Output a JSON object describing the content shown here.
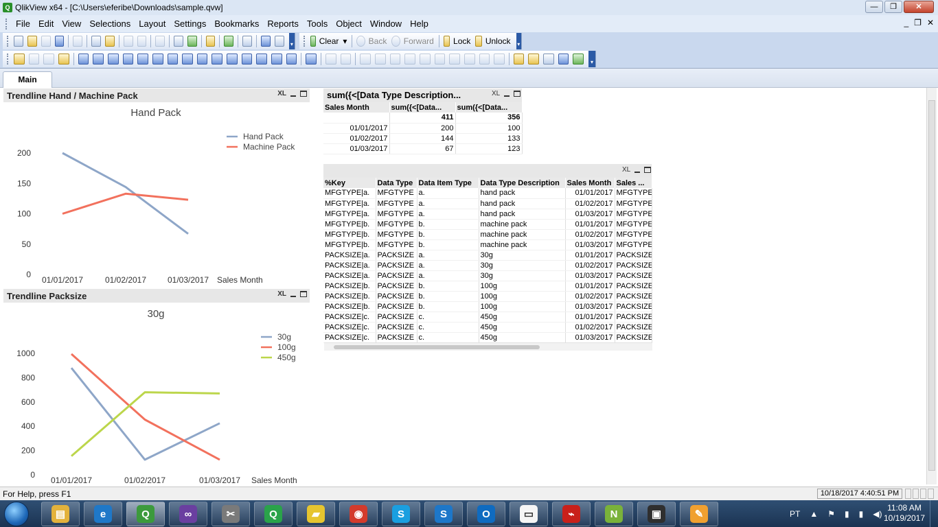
{
  "window": {
    "title": "QlikView x64 - [C:\\Users\\eferibe\\Downloads\\sample.qvw]",
    "min_label": "—",
    "max_label": "❐",
    "close_label": "✕"
  },
  "menu": [
    "File",
    "Edit",
    "View",
    "Selections",
    "Layout",
    "Settings",
    "Bookmarks",
    "Reports",
    "Tools",
    "Object",
    "Window",
    "Help"
  ],
  "mdi_controls": [
    "_",
    "❐",
    "✕"
  ],
  "toolbar": {
    "clear_label": "Clear",
    "back_label": "Back",
    "forward_label": "Forward",
    "lock_label": "Lock",
    "unlock_label": "Unlock"
  },
  "tabs": [
    "Main"
  ],
  "chart1": {
    "caption": "Trendline Hand / Machine Pack",
    "xl": "XL",
    "chart_data": {
      "type": "line",
      "title": "Hand Pack",
      "xlabel": "Sales Month",
      "ylabel": "",
      "categories": [
        "01/01/2017",
        "01/02/2017",
        "01/03/2017"
      ],
      "series": [
        {
          "name": "Hand Pack",
          "values": [
            200,
            144,
            67
          ],
          "color": "#8ea6c8"
        },
        {
          "name": "Machine Pack",
          "values": [
            100,
            133,
            123
          ],
          "color": "#f2715d"
        }
      ],
      "ylim": [
        0,
        200
      ],
      "yticks": [
        0,
        50,
        100,
        150,
        200
      ],
      "legend": "top-right",
      "grid": false
    }
  },
  "chart2": {
    "caption": "Trendline Packsize",
    "xl": "XL",
    "chart_data": {
      "type": "line",
      "title": "30g",
      "xlabel": "Sales Month",
      "ylabel": "",
      "categories": [
        "01/01/2017",
        "01/02/2017",
        "01/03/2017"
      ],
      "series": [
        {
          "name": "30g",
          "values": [
            880,
            125,
            425
          ],
          "color": "#8ea6c8"
        },
        {
          "name": "100g",
          "values": [
            995,
            455,
            125
          ],
          "color": "#f2715d"
        },
        {
          "name": "450g",
          "values": [
            155,
            680,
            670
          ],
          "color": "#bcd64b"
        }
      ],
      "ylim": [
        0,
        1000
      ],
      "yticks": [
        0,
        200,
        400,
        600,
        800,
        1000
      ],
      "legend": "top-right",
      "grid": false
    }
  },
  "pivot": {
    "caption": "sum({<[Data Type Description...",
    "xl": "XL",
    "headers": [
      "Sales Month",
      "sum({<[Data...",
      "sum({<[Data..."
    ],
    "totals": [
      "",
      "411",
      "356"
    ],
    "rows": [
      [
        "01/01/2017",
        "200",
        "100"
      ],
      [
        "01/02/2017",
        "144",
        "133"
      ],
      [
        "01/03/2017",
        "67",
        "123"
      ]
    ]
  },
  "table": {
    "xl": "XL",
    "headers": [
      "%Key",
      "Data Type",
      "Data Item Type",
      "Data Type Description",
      "Sales Month",
      "Sales ..."
    ],
    "rows": [
      [
        "MFGTYPE|a.",
        "MFGTYPE",
        "a.",
        "hand pack",
        "01/01/2017",
        "MFGTYPE"
      ],
      [
        "MFGTYPE|a.",
        "MFGTYPE",
        "a.",
        "hand pack",
        "01/02/2017",
        "MFGTYPE"
      ],
      [
        "MFGTYPE|a.",
        "MFGTYPE",
        "a.",
        "hand pack",
        "01/03/2017",
        "MFGTYPE"
      ],
      [
        "MFGTYPE|b.",
        "MFGTYPE",
        "b.",
        "machine pack",
        "01/01/2017",
        "MFGTYPE"
      ],
      [
        "MFGTYPE|b.",
        "MFGTYPE",
        "b.",
        "machine pack",
        "01/02/2017",
        "MFGTYPE"
      ],
      [
        "MFGTYPE|b.",
        "MFGTYPE",
        "b.",
        "machine pack",
        "01/03/2017",
        "MFGTYPE"
      ],
      [
        "PACKSIZE|a.",
        "PACKSIZE",
        "a.",
        "30g",
        "01/01/2017",
        "PACKSIZE"
      ],
      [
        "PACKSIZE|a.",
        "PACKSIZE",
        "a.",
        "30g",
        "01/02/2017",
        "PACKSIZE"
      ],
      [
        "PACKSIZE|a.",
        "PACKSIZE",
        "a.",
        "30g",
        "01/03/2017",
        "PACKSIZE"
      ],
      [
        "PACKSIZE|b.",
        "PACKSIZE",
        "b.",
        "100g",
        "01/01/2017",
        "PACKSIZE"
      ],
      [
        "PACKSIZE|b.",
        "PACKSIZE",
        "b.",
        "100g",
        "01/02/2017",
        "PACKSIZE"
      ],
      [
        "PACKSIZE|b.",
        "PACKSIZE",
        "b.",
        "100g",
        "01/03/2017",
        "PACKSIZE"
      ],
      [
        "PACKSIZE|c.",
        "PACKSIZE",
        "c.",
        "450g",
        "01/01/2017",
        "PACKSIZE"
      ],
      [
        "PACKSIZE|c.",
        "PACKSIZE",
        "c.",
        "450g",
        "01/02/2017",
        "PACKSIZE"
      ],
      [
        "PACKSIZE|c.",
        "PACKSIZE",
        "c.",
        "450g",
        "01/03/2017",
        "PACKSIZE"
      ]
    ]
  },
  "status": {
    "help": "For Help, press F1",
    "datetime": "10/18/2017 4:40:51 PM"
  },
  "taskbar": {
    "lang": "PT",
    "time": "11:08 AM",
    "date": "10/19/2017",
    "apps": [
      "file-explorer",
      "internet-explorer",
      "qlikview",
      "visual-studio",
      "tools",
      "qlik-sense",
      "sticky-notes",
      "chrome",
      "skype",
      "skype-business",
      "outlook",
      "document-viewer",
      "acrobat",
      "notepad-plus",
      "terminal",
      "paint"
    ]
  }
}
